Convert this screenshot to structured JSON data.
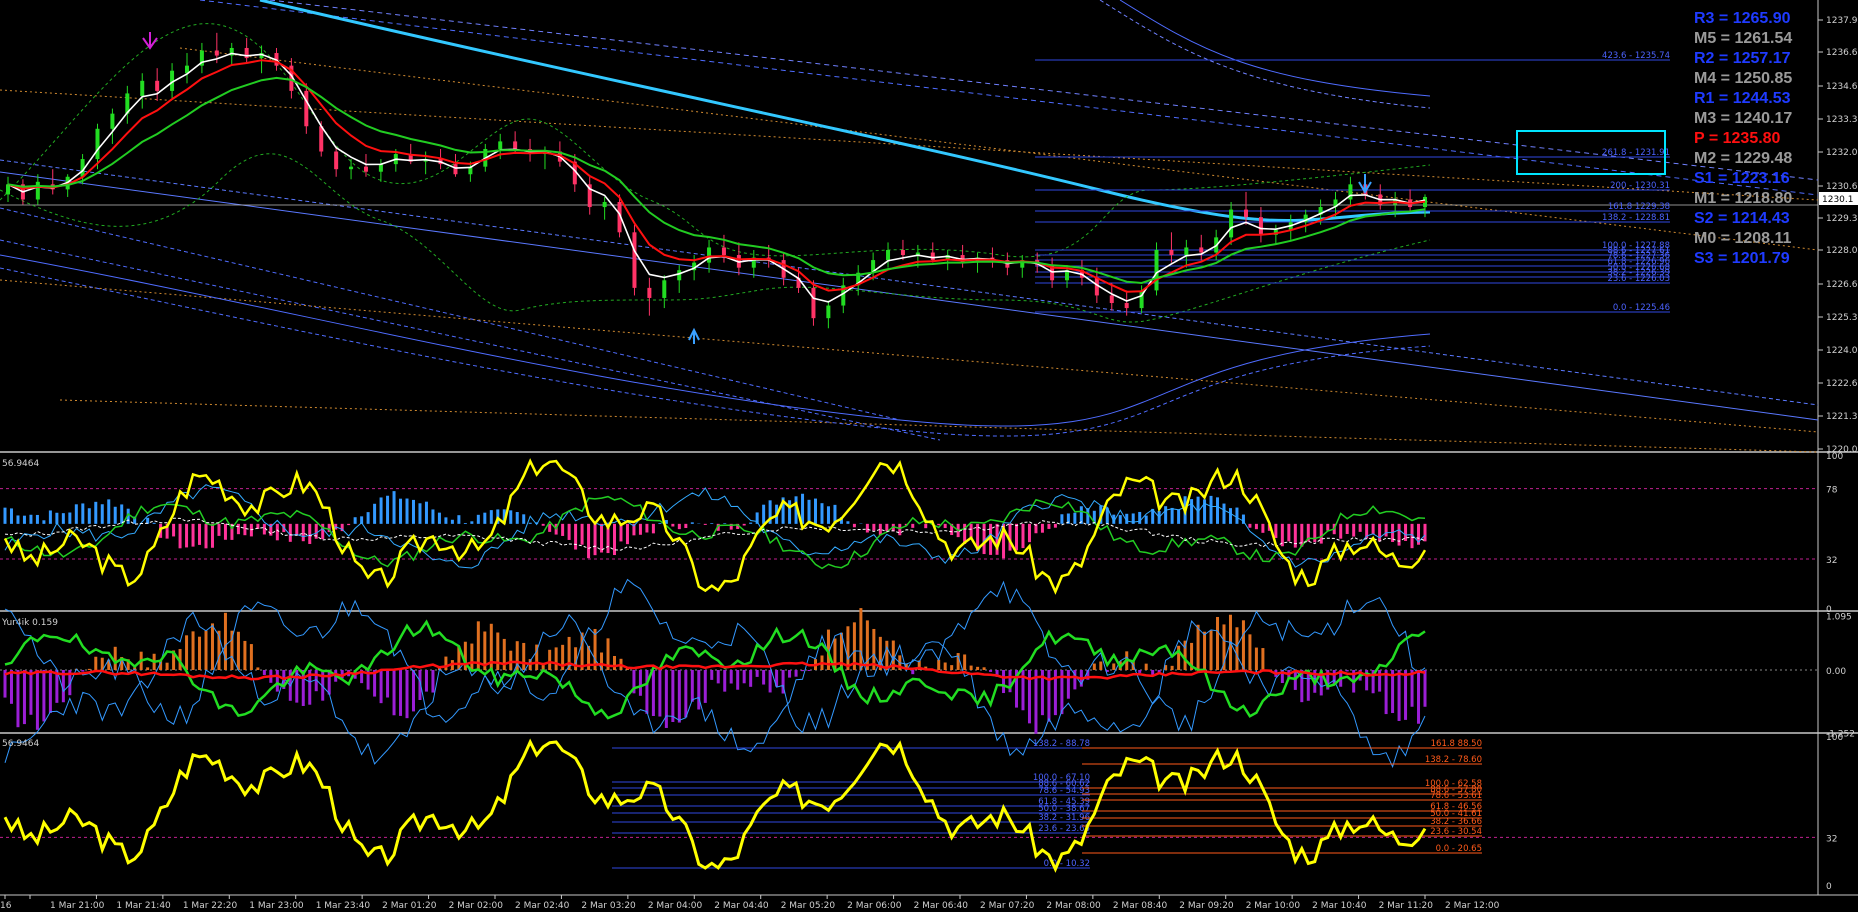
{
  "chart_data": {
    "type": "candlestick",
    "panes": {
      "price": {
        "ylim": [
          1220.0,
          1237.9
        ],
        "yticks": [
          "1237.95",
          "1236.60",
          "1234.60",
          "1233.30",
          "1232.00",
          "1230.65",
          "1229.30",
          "1228.00",
          "1226.65",
          "1225.30",
          "1224.00",
          "1222.65",
          "1221.35",
          "1220.00"
        ],
        "current_price_label": "1230.1",
        "candles": [
          [
            1230.2,
            1230.9,
            1229.9,
            1230.6
          ],
          [
            1230.6,
            1230.8,
            1229.8,
            1230.0
          ],
          [
            1230.0,
            1231.0,
            1229.8,
            1230.7
          ],
          [
            1230.6,
            1231.2,
            1230.2,
            1230.4
          ],
          [
            1230.4,
            1231.0,
            1230.1,
            1230.9
          ],
          [
            1230.9,
            1231.8,
            1230.6,
            1231.6
          ],
          [
            1231.6,
            1233.0,
            1231.2,
            1232.8
          ],
          [
            1232.8,
            1233.6,
            1232.2,
            1233.4
          ],
          [
            1233.4,
            1234.5,
            1233.0,
            1234.2
          ],
          [
            1234.1,
            1235.0,
            1233.6,
            1234.7
          ],
          [
            1234.7,
            1235.2,
            1233.9,
            1234.3
          ],
          [
            1234.3,
            1235.4,
            1234.0,
            1235.1
          ],
          [
            1235.0,
            1235.8,
            1234.6,
            1235.3
          ],
          [
            1235.3,
            1236.2,
            1235.0,
            1235.9
          ],
          [
            1235.9,
            1236.6,
            1235.4,
            1235.7
          ],
          [
            1235.7,
            1236.2,
            1235.3,
            1236.0
          ],
          [
            1236.0,
            1236.4,
            1235.4,
            1235.6
          ],
          [
            1235.6,
            1236.1,
            1235.0,
            1235.8
          ],
          [
            1235.8,
            1236.0,
            1235.1,
            1235.3
          ],
          [
            1235.3,
            1235.6,
            1234.0,
            1234.3
          ],
          [
            1234.3,
            1234.6,
            1232.6,
            1232.9
          ],
          [
            1232.9,
            1233.1,
            1231.7,
            1231.9
          ],
          [
            1231.9,
            1232.1,
            1230.9,
            1231.2
          ],
          [
            1231.2,
            1231.6,
            1230.8,
            1231.3
          ],
          [
            1231.3,
            1231.8,
            1230.9,
            1231.1
          ],
          [
            1231.1,
            1231.6,
            1230.7,
            1231.4
          ],
          [
            1231.4,
            1232.0,
            1231.1,
            1231.8
          ],
          [
            1231.8,
            1232.2,
            1231.4,
            1231.5
          ],
          [
            1231.5,
            1231.9,
            1231.0,
            1231.6
          ],
          [
            1231.6,
            1232.0,
            1231.2,
            1231.4
          ],
          [
            1231.4,
            1231.8,
            1230.9,
            1231.0
          ],
          [
            1231.0,
            1231.5,
            1230.7,
            1231.3
          ],
          [
            1231.3,
            1232.2,
            1231.1,
            1232.0
          ],
          [
            1232.0,
            1232.6,
            1231.6,
            1232.3
          ],
          [
            1232.3,
            1232.7,
            1231.8,
            1232.0
          ],
          [
            1232.0,
            1232.4,
            1231.5,
            1231.8
          ],
          [
            1231.8,
            1232.1,
            1231.2,
            1231.9
          ],
          [
            1231.9,
            1232.3,
            1231.3,
            1231.5
          ],
          [
            1231.5,
            1231.8,
            1230.3,
            1230.6
          ],
          [
            1230.6,
            1230.9,
            1229.4,
            1229.7
          ],
          [
            1229.7,
            1230.1,
            1229.2,
            1229.9
          ],
          [
            1229.9,
            1230.2,
            1228.5,
            1228.7
          ],
          [
            1228.7,
            1229.0,
            1226.2,
            1226.5
          ],
          [
            1226.5,
            1226.9,
            1225.4,
            1226.1
          ],
          [
            1226.1,
            1227.0,
            1225.7,
            1226.8
          ],
          [
            1226.8,
            1227.4,
            1226.3,
            1227.2
          ],
          [
            1227.2,
            1227.8,
            1226.8,
            1227.5
          ],
          [
            1227.5,
            1228.4,
            1227.1,
            1228.1
          ],
          [
            1228.1,
            1228.6,
            1227.5,
            1227.8
          ],
          [
            1227.8,
            1228.3,
            1227.0,
            1227.3
          ],
          [
            1227.3,
            1228.0,
            1226.9,
            1227.7
          ],
          [
            1227.7,
            1228.2,
            1227.3,
            1227.6
          ],
          [
            1227.6,
            1227.9,
            1226.6,
            1226.9
          ],
          [
            1226.9,
            1227.3,
            1226.3,
            1226.5
          ],
          [
            1226.5,
            1226.8,
            1225.0,
            1225.3
          ],
          [
            1225.3,
            1226.0,
            1224.9,
            1225.8
          ],
          [
            1225.8,
            1226.9,
            1225.5,
            1226.6
          ],
          [
            1226.6,
            1227.4,
            1226.2,
            1227.1
          ],
          [
            1227.1,
            1227.9,
            1226.8,
            1227.6
          ],
          [
            1227.6,
            1228.3,
            1227.3,
            1228.0
          ],
          [
            1228.0,
            1228.4,
            1227.6,
            1227.8
          ],
          [
            1227.8,
            1228.2,
            1227.3,
            1227.9
          ],
          [
            1227.9,
            1228.3,
            1227.5,
            1227.6
          ],
          [
            1227.6,
            1228.0,
            1227.2,
            1227.8
          ],
          [
            1227.8,
            1228.2,
            1227.3,
            1227.5
          ],
          [
            1227.5,
            1227.9,
            1227.1,
            1227.7
          ],
          [
            1227.7,
            1228.1,
            1227.3,
            1227.6
          ],
          [
            1227.6,
            1227.9,
            1227.0,
            1227.3
          ],
          [
            1227.3,
            1227.8,
            1226.9,
            1227.6
          ],
          [
            1227.6,
            1227.9,
            1227.1,
            1227.4
          ],
          [
            1227.4,
            1227.7,
            1226.5,
            1226.8
          ],
          [
            1226.8,
            1227.4,
            1226.5,
            1227.2
          ],
          [
            1227.2,
            1227.6,
            1226.6,
            1226.9
          ],
          [
            1226.9,
            1227.3,
            1225.9,
            1226.2
          ],
          [
            1226.2,
            1226.7,
            1225.6,
            1225.9
          ],
          [
            1225.9,
            1226.4,
            1225.4,
            1225.7
          ],
          [
            1225.7,
            1226.6,
            1225.5,
            1226.4
          ],
          [
            1226.4,
            1228.3,
            1226.2,
            1228.0
          ],
          [
            1228.0,
            1228.7,
            1227.5,
            1227.8
          ],
          [
            1227.8,
            1228.4,
            1227.3,
            1228.1
          ],
          [
            1228.1,
            1228.6,
            1227.6,
            1227.9
          ],
          [
            1227.9,
            1228.8,
            1227.6,
            1228.5
          ],
          [
            1228.5,
            1229.9,
            1228.2,
            1229.6
          ],
          [
            1229.6,
            1230.3,
            1229.0,
            1229.3
          ],
          [
            1229.3,
            1229.7,
            1228.3,
            1228.6
          ],
          [
            1228.6,
            1229.0,
            1228.2,
            1228.8
          ],
          [
            1228.8,
            1229.4,
            1228.4,
            1229.1
          ],
          [
            1229.1,
            1229.6,
            1228.7,
            1229.4
          ],
          [
            1229.4,
            1230.0,
            1229.0,
            1229.7
          ],
          [
            1229.7,
            1230.3,
            1229.3,
            1230.0
          ],
          [
            1230.0,
            1230.9,
            1229.7,
            1230.6
          ],
          [
            1230.6,
            1231.0,
            1230.0,
            1230.2
          ],
          [
            1230.2,
            1230.6,
            1229.6,
            1229.8
          ],
          [
            1229.8,
            1230.3,
            1229.3,
            1230.0
          ],
          [
            1230.0,
            1230.4,
            1229.5,
            1229.7
          ],
          [
            1229.7,
            1230.2,
            1229.3,
            1230.1
          ]
        ]
      },
      "osc1": {
        "label": "56.9464",
        "yticks": [
          "100",
          "78",
          "32",
          "0"
        ]
      },
      "osc2": {
        "label": "Yur4ik 0.159",
        "yticks": [
          "1.095",
          "0.00",
          "-1.252"
        ]
      },
      "osc3": {
        "label": "56.9464",
        "yticks": [
          "100",
          "32",
          "0"
        ]
      }
    },
    "fib_price": [
      "423.6 - 1235.74",
      "261.8 - 1231.91",
      "200 - 1230.31",
      "161.8 1229.38",
      "138.2 - 1228.81",
      "100.0 - 1227.88",
      "88.6 - 1227.61",
      "78.6 - 1227.36",
      "61.8 - 1226.96",
      "50.0 - 1226.68",
      "38.2 - 1226.39",
      "23.6 - 1226.03",
      "0.0 - 1225.46"
    ],
    "fib_osc_blue": [
      "138.2 - 88.78",
      "100.0 - 67.10",
      "88.6 - 60.62",
      "78.6 - 54.93",
      "61.8 - 45.39",
      "50.0 - 38.67",
      "38.2 - 31.96",
      "23.6 - 23.65",
      "0.0 - 10.32"
    ],
    "fib_osc_orange": [
      "161.8 88.50",
      "138.2 - 78.60",
      "100.0 - 62.58",
      "88.6 - 57.80",
      "78.6 - 53.61",
      "61.8 - 46.56",
      "50.0 - 41.61",
      "38.2 - 36.66",
      "23.6 - 30.54",
      "0.0 - 20.65"
    ],
    "xticks": [
      "16",
      "1 Mar 21:00",
      "1 Mar 21:40",
      "1 Mar 22:20",
      "1 Mar 23:00",
      "1 Mar 23:40",
      "2 Mar 01:20",
      "2 Mar 02:00",
      "2 Mar 02:40",
      "2 Mar 03:20",
      "2 Mar 04:00",
      "2 Mar 04:40",
      "2 Mar 05:20",
      "2 Mar 06:00",
      "2 Mar 06:40",
      "2 Mar 07:20",
      "2 Mar 08:00",
      "2 Mar 08:40",
      "2 Mar 09:20",
      "2 Mar 10:00",
      "2 Mar 10:40",
      "2 Mar 11:20",
      "2 Mar 12:00"
    ],
    "pivots": [
      {
        "label": "R3 = 1265.90",
        "color": "#1f3bff"
      },
      {
        "label": "M5 = 1261.54",
        "color": "#9a9a9a"
      },
      {
        "label": "R2 = 1257.17",
        "color": "#1f3bff"
      },
      {
        "label": "M4 = 1250.85",
        "color": "#9a9a9a"
      },
      {
        "label": "R1 = 1244.53",
        "color": "#1f3bff"
      },
      {
        "label": "M3 = 1240.17",
        "color": "#9a9a9a"
      },
      {
        "label": "P  = 1235.80",
        "color": "#ff1010"
      },
      {
        "label": "M2 = 1229.48",
        "color": "#9a9a9a"
      },
      {
        "label": "S1 = 1223.16",
        "color": "#1f3bff"
      },
      {
        "label": "M1 = 1218.80",
        "color": "#9a9a9a"
      },
      {
        "label": "S2 = 1214.43",
        "color": "#1f3bff"
      },
      {
        "label": "M0 = 1208.11",
        "color": "#9a9a9a"
      },
      {
        "label": "S3 = 1201.79",
        "color": "#1f3bff"
      }
    ],
    "colors": {
      "bull": "#22dd22",
      "bear": "#ff3366",
      "ma_white": "#ffffff",
      "ma_red": "#ff1010",
      "ma_green": "#22cc22",
      "regression": "#33c8ff",
      "osc_yellow": "#ffff00",
      "hist_blue": "#3399ff",
      "hist_pink": "#ff3399",
      "hist_orange": "#e07020",
      "hist_purple": "#9b1fd6"
    }
  }
}
